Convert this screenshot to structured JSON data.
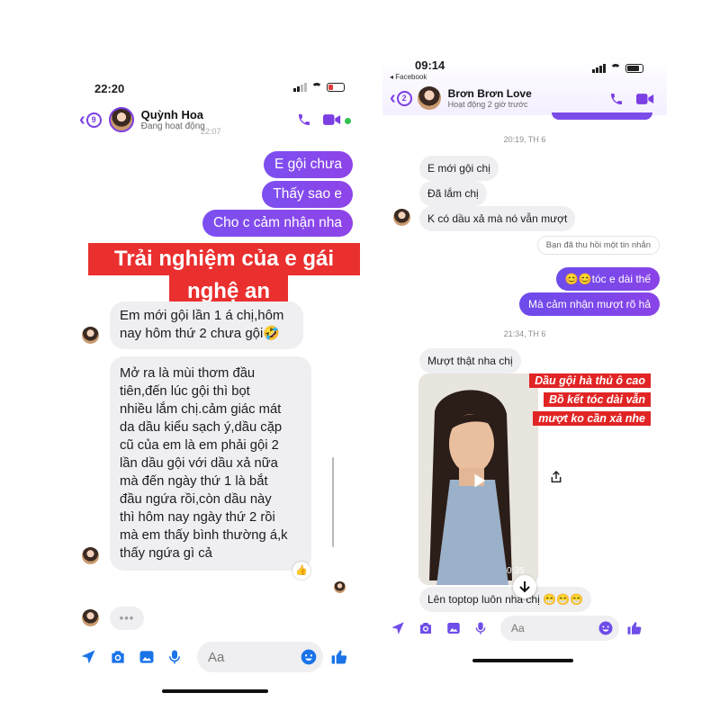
{
  "left": {
    "status_time": "22:20",
    "header": {
      "back_count": "9",
      "name": "Quỳnh Hoa",
      "status": "Đang hoạt động",
      "hidden_time": "22:07"
    },
    "outgoing": [
      "E gội chưa",
      "Thấy sao e",
      "Cho c cảm nhận nha"
    ],
    "banner": [
      "Trải nghiệm của e gái",
      "nghệ an"
    ],
    "incoming": [
      [
        "Em mới gội lần 1 á chị,hôm",
        "nay hôm thứ 2 chưa gội🤣"
      ],
      [
        "Mở ra là mùi thơm đầu",
        "tiên,đến lúc gội thì bọt",
        "nhiều lắm chị.cảm giác mát",
        "da dầu kiểu sạch ý,dầu cặp",
        "cũ của em là em phải gội 2",
        "lần dầu gội với dầu xả nữa",
        "mà đến ngày thứ 1 là bắt",
        "đầu ngứa rồi,còn dầu này",
        "thì hôm nay ngày thứ 2 rồi",
        "mà em thấy bình thường á,k",
        "thấy ngứa gì cả"
      ]
    ],
    "reaction": "👍",
    "typing": "•••",
    "composer_placeholder": "Aa"
  },
  "right": {
    "status_time": "09:14",
    "back_app": "◂ Facebook",
    "header": {
      "back_count": "2",
      "name": "Brơn Brơn Love",
      "status": "Hoạt động 2 giờ trước"
    },
    "ts1": "20:19, TH 6",
    "incoming1": [
      "E mới gội chị",
      "Đã lắm chị",
      "K có dầu xả mà nó vẫn mượt"
    ],
    "unsent": "Bạn đã thu hồi một tin nhắn",
    "outgoing": [
      "😊😊tóc e dài thế",
      "Mà cảm nhận mượt rõ hả"
    ],
    "ts2": "21:34, TH 6",
    "incoming2": "Mượt thật nha chị",
    "video_caption": [
      "Dầu gội hà thủ ô cao",
      "Bồ kết tóc dài vẫn",
      "mượt ko cần xả nhe"
    ],
    "video_duration": "0:35",
    "last_message": "Lên toptop luôn nha chị 😁😁😁",
    "composer_placeholder": "Aa"
  },
  "colors": {
    "accent": "#7b3fe4",
    "bubble_out": "#7c4ff0",
    "bubble_in": "#efeff1",
    "banner": "#ea2f2f",
    "like": "#6f4de8"
  }
}
